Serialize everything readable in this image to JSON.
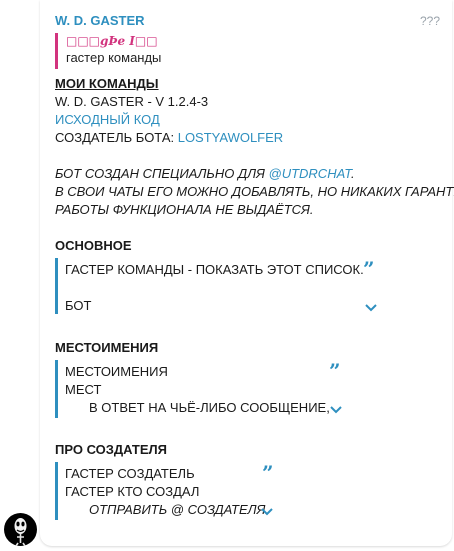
{
  "message": {
    "sender": "W. D. GASTER",
    "message_id": "???",
    "reply": {
      "title": "□□□gÞе I□□",
      "text": "гастер команды"
    },
    "header": "МОИ КОМАНДЫ",
    "version": "W. D. GASTER - V 1.2.4-3",
    "source_link": "ИСХОДНЫЙ КОД",
    "creator_label": "СОЗДАТЕЛЬ БОТА: ",
    "creator_link": "LOSTYAWOLFER",
    "note": {
      "line1_prefix": "БОТ СОЗДАН СПЕЦИАЛЬНО ДЛЯ ",
      "line1_link": "@UTDRCHAT",
      "line1_suffix": ".",
      "line2": "В СВОИ ЧАТЫ ЕГО МОЖНО ДОБАВЛЯТЬ, НО НИКАКИХ ГАРАНТИЙ",
      "line3": "РАБОТЫ ФУНКЦИОНАЛА НЕ ВЫДАЁТСЯ."
    },
    "sections": {
      "main": {
        "title": "ОСНОВНОЕ",
        "line1": "ГАСТЕР КОМАНДЫ - ПОКАЗАТЬ ЭТОТ СПИСОК.",
        "line2": "БОТ"
      },
      "pronouns": {
        "title": "МЕСТОИМЕНИЯ",
        "line1": "МЕСТОИМЕНИЯ",
        "line2": "МЕСТ",
        "line3": "В ОТВЕТ НА ЧЬЁ-ЛИБО СООБЩЕНИЕ,"
      },
      "creator": {
        "title": "ПРО СОЗДАТЕЛЯ",
        "line1": "ГАСТЕР СОЗДАТЕЛЬ",
        "line2": "ГАСТЕР КТО СОЗДАЛ",
        "line3": "ОТПРАВИТЬ @ СОЗДАТЕЛЯ"
      }
    }
  },
  "colors": {
    "accent": "#2e8fbf",
    "reply_accent": "#d2337e"
  },
  "icons": {
    "quote": "quote-mark-icon",
    "expand": "chevron-down-icon",
    "avatar": "gaster-avatar"
  }
}
